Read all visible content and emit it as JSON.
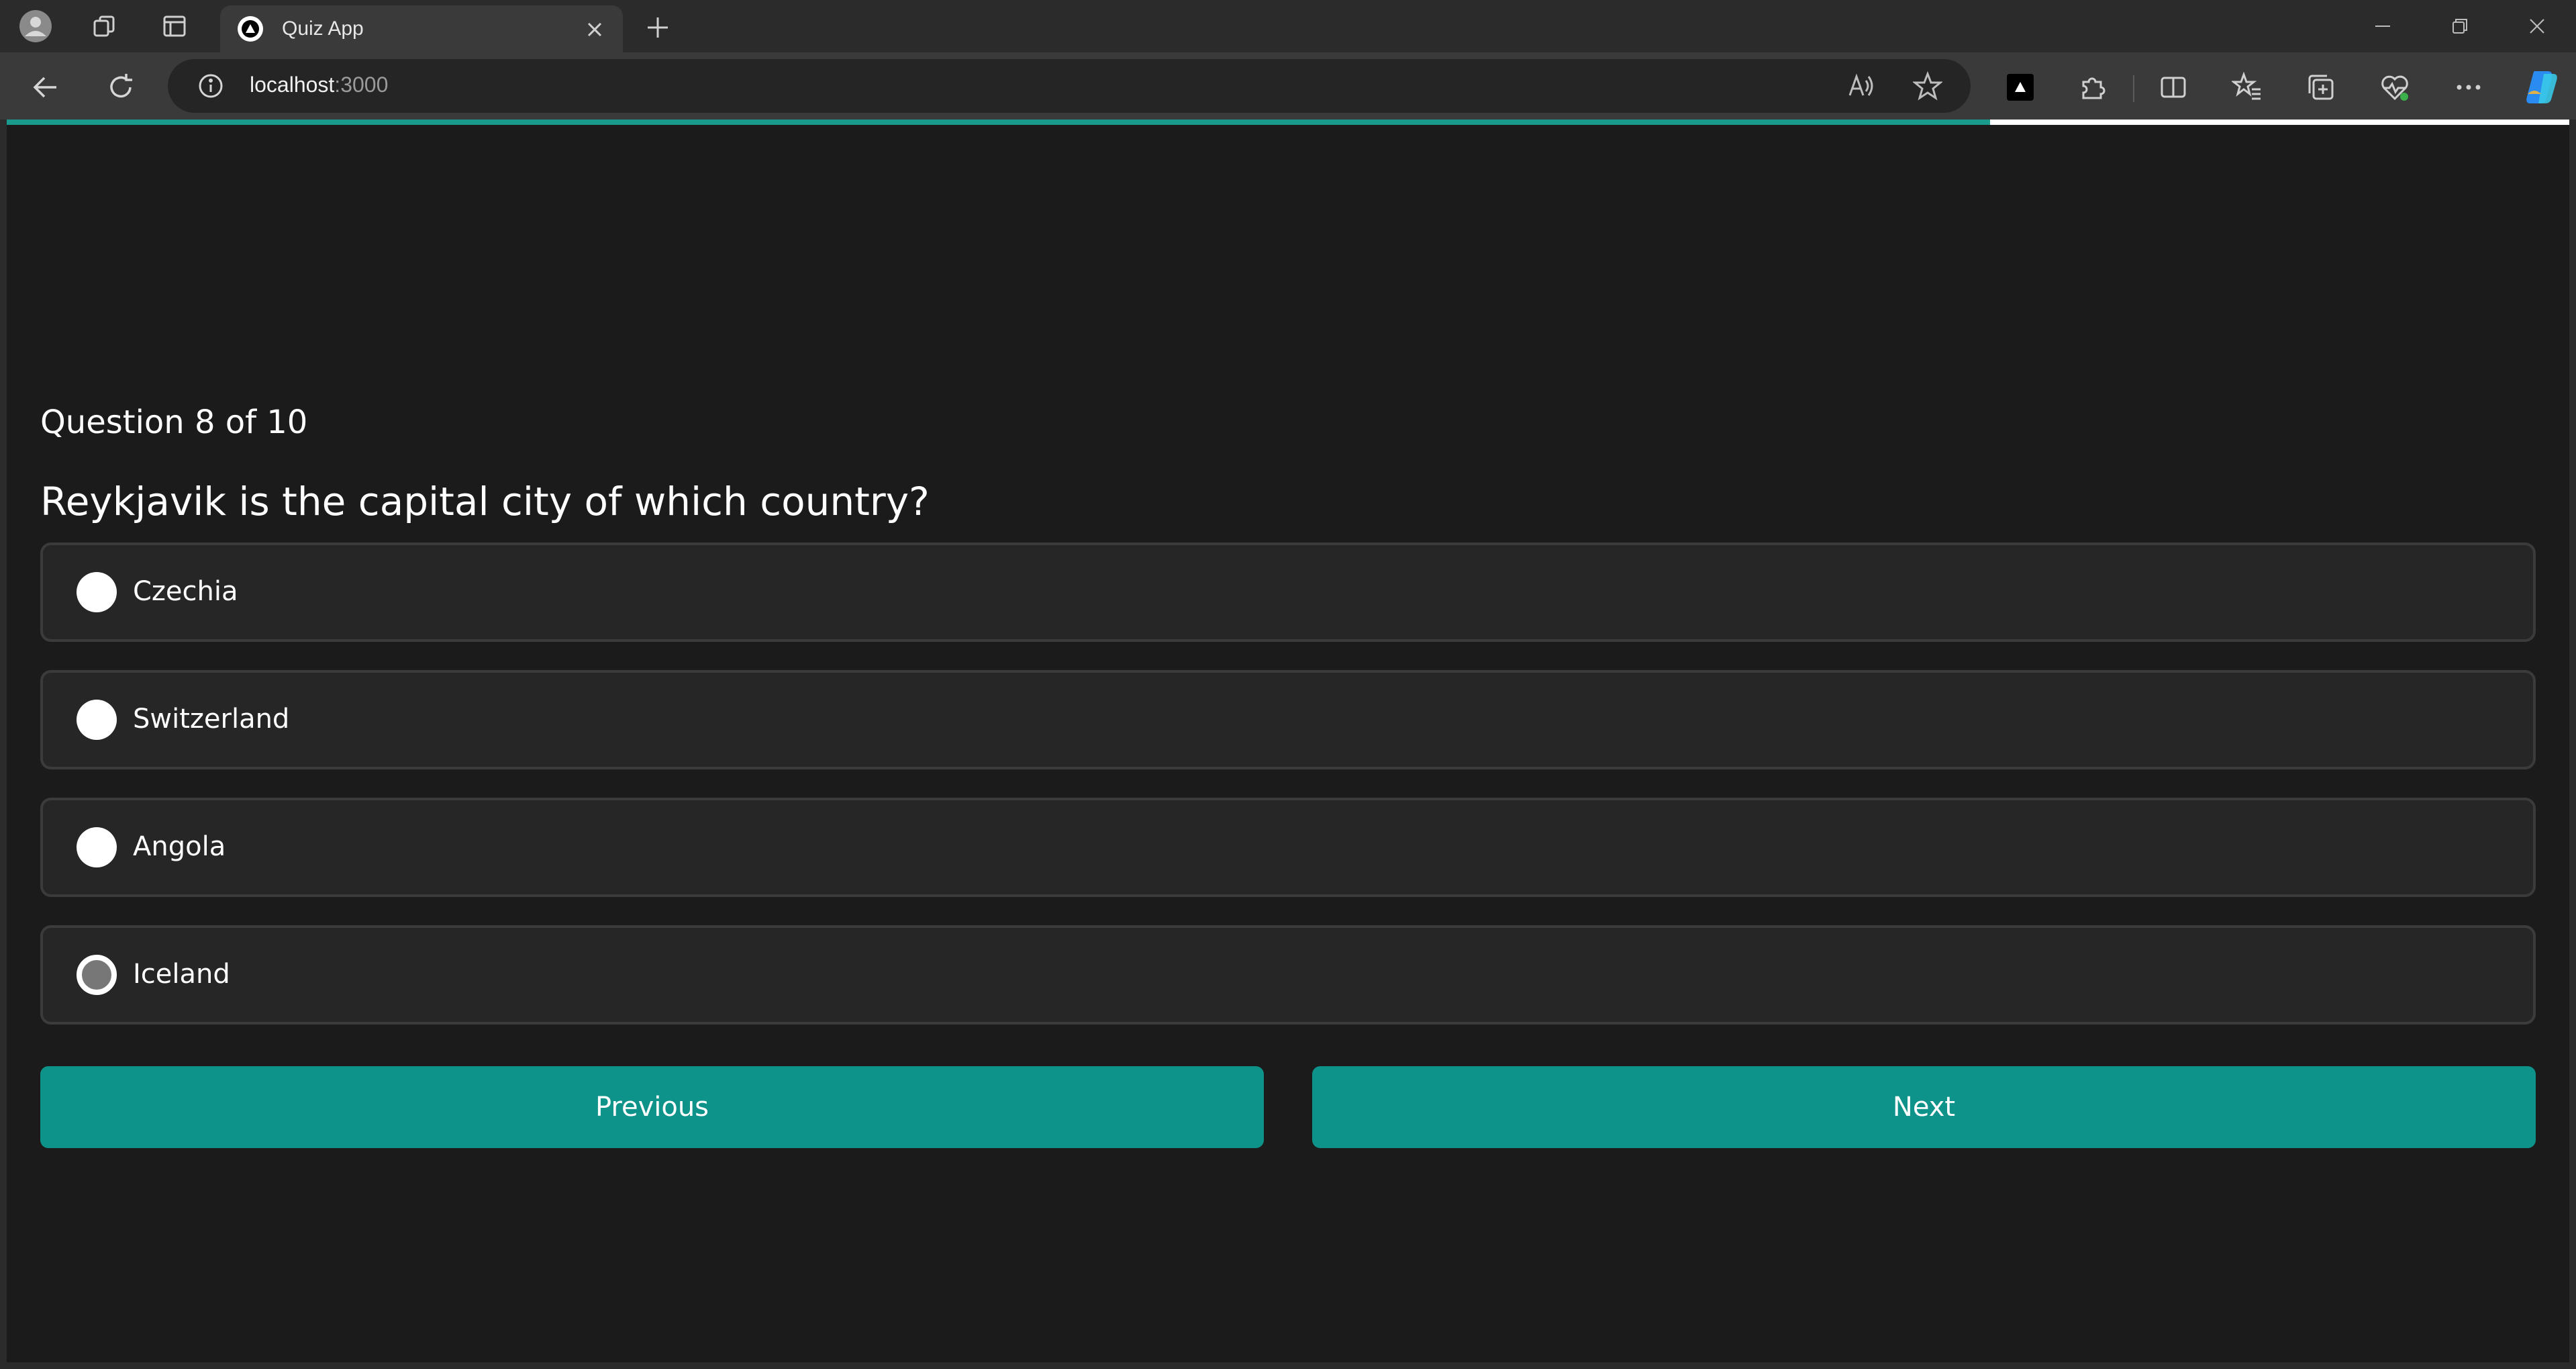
{
  "browser": {
    "tab": {
      "title": "Quiz App"
    },
    "address": {
      "host": "localhost",
      "port": ":3000"
    }
  },
  "quiz": {
    "progress_fraction": 0.774,
    "counter": "Question 8 of 10",
    "question": "Reykjavik is the capital city of which country?",
    "options": [
      {
        "label": "Czechia",
        "selected": false
      },
      {
        "label": "Switzerland",
        "selected": false
      },
      {
        "label": "Angola",
        "selected": false
      },
      {
        "label": "Iceland",
        "selected": true
      }
    ],
    "previous_label": "Previous",
    "next_label": "Next"
  },
  "colors": {
    "accent": "#0e938a",
    "page_background": "#1b1b1b",
    "option_background": "#262626",
    "browser_chrome": "#2b2b2b"
  },
  "icons": {
    "tabbar": [
      "profile-icon",
      "workspaces-icon",
      "tab-actions-icon",
      "close-icon",
      "plus-icon",
      "minimize-icon",
      "restore-icon",
      "window-close-icon"
    ],
    "toolbar": [
      "back-arrow-icon",
      "refresh-icon",
      "info-icon",
      "read-aloud-icon",
      "star-icon",
      "extension-logo-icon",
      "puzzle-icon",
      "split-screen-icon",
      "favorites-icon",
      "collections-icon",
      "health-icon",
      "more-icon",
      "copilot-icon"
    ]
  }
}
